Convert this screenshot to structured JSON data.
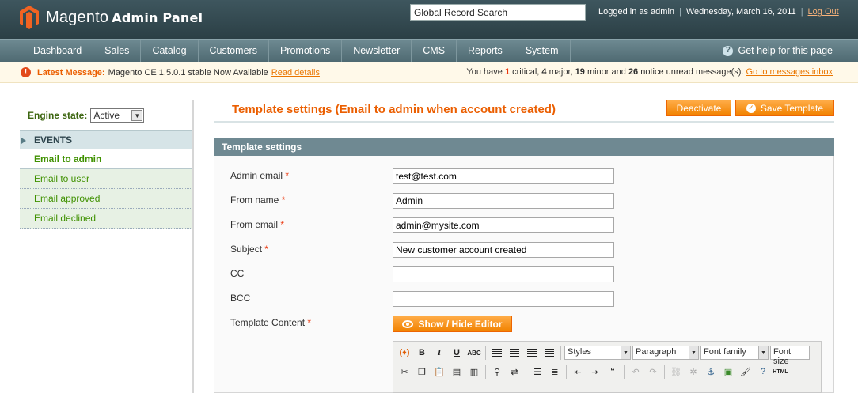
{
  "header": {
    "app_title": "Magento",
    "app_subtitle": "Admin Panel",
    "search_value": "Global Record Search",
    "logged_in": "Logged in as admin",
    "date": "Wednesday, March 16, 2011",
    "logout": "Log Out"
  },
  "nav": {
    "items": [
      "Dashboard",
      "Sales",
      "Catalog",
      "Customers",
      "Promotions",
      "Newsletter",
      "CMS",
      "Reports",
      "System"
    ],
    "help": "Get help for this page"
  },
  "message": {
    "latest_label": "Latest Message:",
    "latest_text": "Magento CE 1.5.0.1 stable Now Available",
    "read_details": "Read details",
    "you_have": "You have",
    "critical_count": "1",
    "critical_label": "critical,",
    "major_count": "4",
    "major_label": "major,",
    "minor_count": "19",
    "minor_label": "minor and",
    "notice_count": "26",
    "notice_label": "notice unread message(s).",
    "inbox_link": "Go to messages inbox"
  },
  "sidebar": {
    "engine_label": "Engine state:",
    "engine_value": "Active",
    "section": "EVENTS",
    "items": [
      "Email to admin",
      "Email to user",
      "Email approved",
      "Email declined"
    ]
  },
  "main": {
    "title": "Template settings (Email to admin when account created)",
    "deactivate": "Deactivate",
    "save": "Save Template",
    "fieldset_title": "Template settings",
    "fields": {
      "admin_email": {
        "label": "Admin email",
        "value": "test@test.com"
      },
      "from_name": {
        "label": "From name",
        "value": "Admin"
      },
      "from_email": {
        "label": "From email",
        "value": "admin@mysite.com"
      },
      "subject": {
        "label": "Subject",
        "value": "New customer account created"
      },
      "cc": {
        "label": "CC",
        "value": ""
      },
      "bcc": {
        "label": "BCC",
        "value": ""
      },
      "content": {
        "label": "Template Content"
      }
    },
    "required_mark": "*",
    "show_hide": "Show / Hide Editor"
  },
  "editor": {
    "styles": "Styles",
    "paragraph": "Paragraph",
    "font_family": "Font family",
    "font_size": "Font size",
    "bold": "B",
    "italic": "I",
    "underline": "U",
    "strike": "ABC",
    "html_label": "HTML"
  },
  "colors": {
    "accent": "#eb5e00",
    "header": "#2b3f45",
    "nav": "#5f7b83",
    "sidebar_link": "#3f9100",
    "button": "#f18200"
  }
}
